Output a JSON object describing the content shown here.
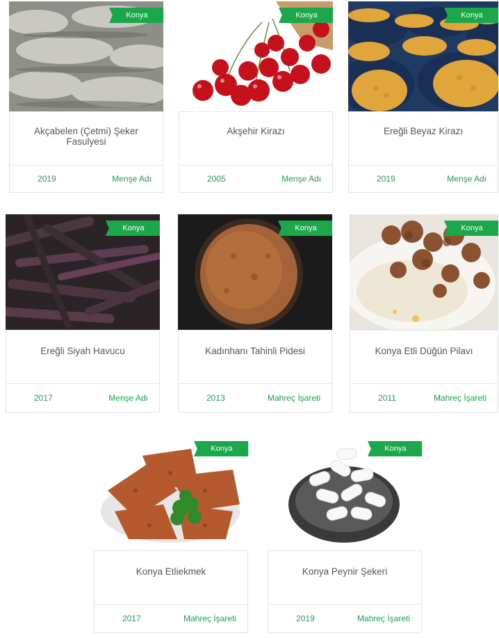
{
  "cards": [
    {
      "title": "Akçabelen (Çetmi) Şeker Fasulyesi",
      "year": "2019",
      "type": "Menşe Adı",
      "region": "Konya",
      "image": "beans"
    },
    {
      "title": "Akşehir Kirazı",
      "year": "2005",
      "type": "Menşe Adı",
      "region": "Konya",
      "image": "cherries"
    },
    {
      "title": "Ereğli Beyaz Kirazı",
      "year": "2019",
      "type": "Menşe Adı",
      "region": "Konya",
      "image": "chickpeas"
    },
    {
      "title": "Ereğli Siyah Havucu",
      "year": "2017",
      "type": "Menşe Adı",
      "region": "Konya",
      "image": "carrots"
    },
    {
      "title": "Kadınhanı Tahinli Pidesi",
      "year": "2013",
      "type": "Mahreç İşareti",
      "region": "Konya",
      "image": "tahini-bread"
    },
    {
      "title": "Konya Etli Düğün Pilavı",
      "year": "2011",
      "type": "Mahreç İşareti",
      "region": "Konya",
      "image": "pilaf"
    },
    {
      "title": "Konya Etliekmek",
      "year": "2017",
      "type": "Mahreç İşareti",
      "region": "Konya",
      "image": "etliekmek"
    },
    {
      "title": "Konya Peynir Şekeri",
      "year": "2019",
      "type": "Mahreç İşareti",
      "region": "Konya",
      "image": "cheese-candy"
    }
  ]
}
